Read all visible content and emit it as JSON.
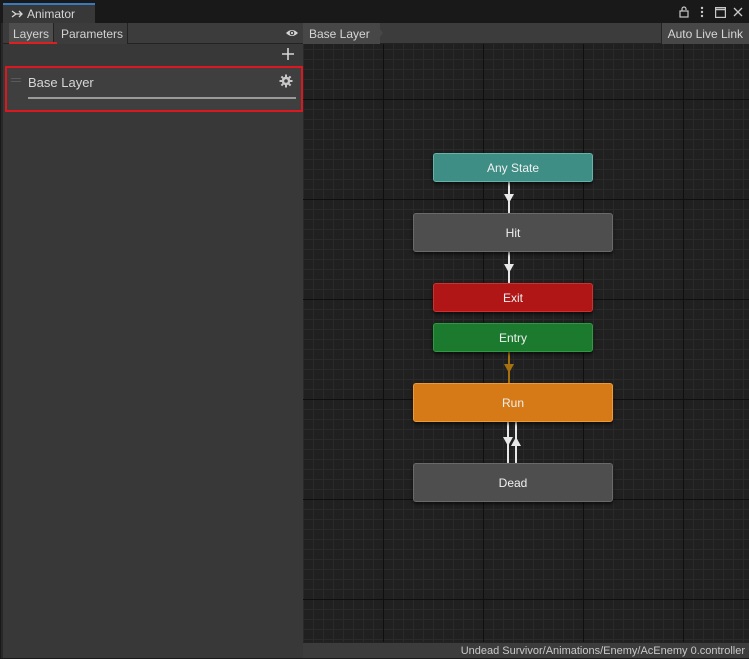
{
  "window": {
    "tab_label": "Animator"
  },
  "left_panel": {
    "tabs": [
      {
        "label": "Layers",
        "active": true
      },
      {
        "label": "Parameters",
        "active": false
      }
    ],
    "layers": [
      {
        "name": "Base Layer"
      }
    ]
  },
  "graph": {
    "breadcrumb": "Base Layer",
    "auto_live_link": "Auto Live Link",
    "states": {
      "any_state": "Any State",
      "hit": "Hit",
      "exit": "Exit",
      "entry": "Entry",
      "run": "Run",
      "dead": "Dead"
    },
    "status_path": "Undead Survivor/Animations/Enemy/AcEnemy 0.controller"
  },
  "colors": {
    "accent_tab": "#3a79bb",
    "highlight": "#d9191f",
    "any_state": "#3e8e86",
    "exit": "#b11616",
    "entry": "#1c7a2e",
    "run_default": "#d57a16",
    "state_gray": "#4e4e4e"
  },
  "icons": [
    "animator-icon",
    "lock-icon",
    "more-icon",
    "maximize-icon",
    "eye-icon",
    "plus-icon",
    "gear-icon"
  ]
}
